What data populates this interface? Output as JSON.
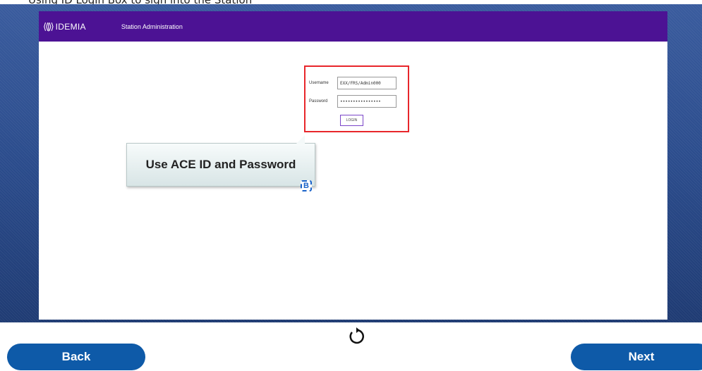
{
  "top_caption": "Using ID Login Box to sign into the Station",
  "app": {
    "brand": "IDEMIA",
    "title": "Station Administration"
  },
  "login": {
    "username_label": "Username",
    "username_value": "EXX/FRS/Admin000",
    "password_label": "Password",
    "password_value": "••••••••••••••••",
    "button_label": "LOGIN"
  },
  "callout": {
    "text": "Use ACE ID and Password",
    "badge": "B"
  },
  "nav": {
    "back": "Back",
    "next": "Next"
  },
  "colors": {
    "header": "#4c1294",
    "highlight": "#e8262b",
    "nav_button": "#0e5aa8",
    "background": "#2b4c8c"
  },
  "icons": [
    "idemia-logo-icon",
    "replay-icon"
  ]
}
